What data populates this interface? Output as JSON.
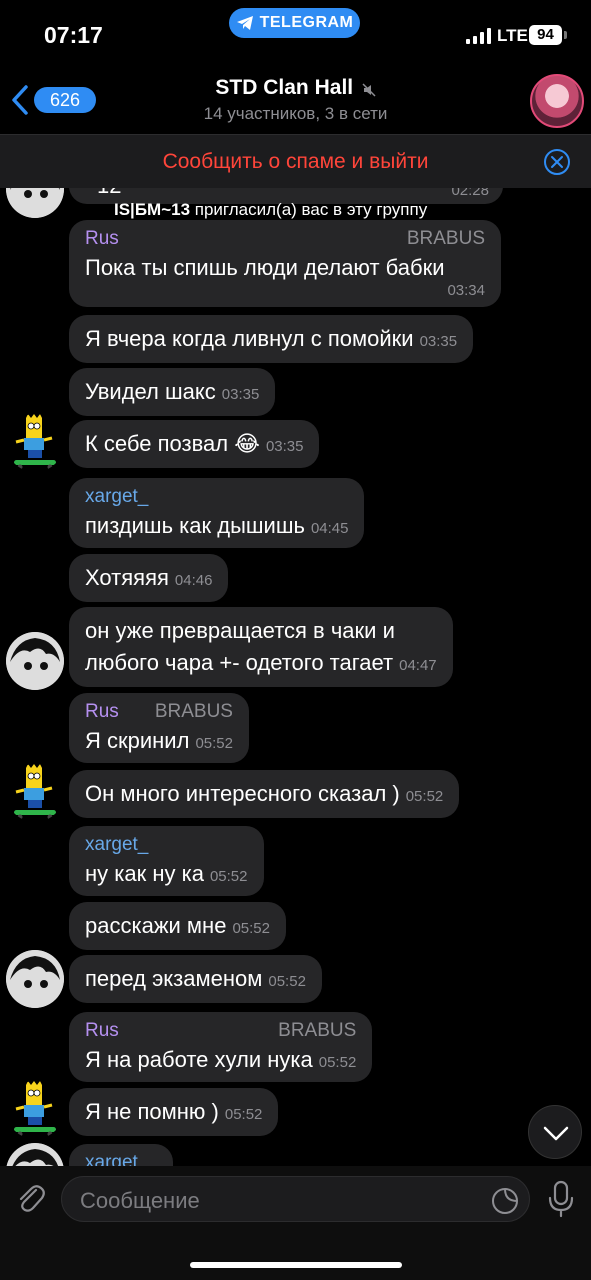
{
  "status_bar": {
    "time": "07:17",
    "app_pill": "TELEGRAM",
    "network": "LTE",
    "battery": "94"
  },
  "header": {
    "back_count": "626",
    "title": "STD Clan Hall",
    "subtitle": "14 участников, 3 в сети"
  },
  "spam_bar": {
    "text": "Сообщить о спаме и выйти"
  },
  "messages": {
    "top_cut": {
      "text": "12",
      "time": "02:28"
    },
    "service": {
      "user": "IS|БМ~13",
      "text": " пригласил(а) вас в эту группу"
    },
    "m1": {
      "sender": "Rus",
      "role": "BRABUS",
      "text": "Пока ты спишь люди делают бабки",
      "time": "03:34"
    },
    "m2": {
      "text": "Я вчера когда ливнул с помойки",
      "time": "03:35"
    },
    "m3": {
      "text": "Увидел шакс",
      "time": "03:35"
    },
    "m4": {
      "text": "К себе позвал 😂",
      "time": "03:35"
    },
    "m5": {
      "sender": "xarget_",
      "text": "пиздишь как дышишь",
      "time": "04:45"
    },
    "m6": {
      "text": "Хотяяяя",
      "time": "04:46"
    },
    "m7": {
      "text_line1": "он уже превращается в чаки и",
      "text_line2": "любого чара +- одетого тагает",
      "time": "04:47"
    },
    "m8": {
      "sender": "Rus",
      "role": "BRABUS",
      "text": "Я скринил",
      "time": "05:52"
    },
    "m9": {
      "text": "Он много интересного сказал )",
      "time": "05:52"
    },
    "m10": {
      "sender": "xarget_",
      "text": "ну как ну ка",
      "time": "05:52"
    },
    "m11": {
      "text": "расскажи мне",
      "time": "05:52"
    },
    "m12": {
      "text": "перед экзаменом",
      "time": "05:52"
    },
    "m13": {
      "sender": "Rus",
      "role": "BRABUS",
      "text": "Я на работе хули нука",
      "time": "05:52"
    },
    "m14": {
      "text": "Я не помню )",
      "time": "05:52"
    },
    "m15": {
      "sender": "xarget"
    }
  },
  "input": {
    "placeholder": "Сообщение"
  },
  "colors": {
    "accent": "#2f8cf3",
    "spam": "#ff453a",
    "bubble": "#262628",
    "sender_rus": "#b590f0",
    "sender_xarget": "#68a8e8"
  },
  "icons": [
    "back-chevron-icon",
    "mute-icon",
    "close-circle-icon",
    "chevron-down-icon",
    "paperclip-icon",
    "sticker-icon",
    "microphone-icon",
    "telegram-plane-icon"
  ]
}
